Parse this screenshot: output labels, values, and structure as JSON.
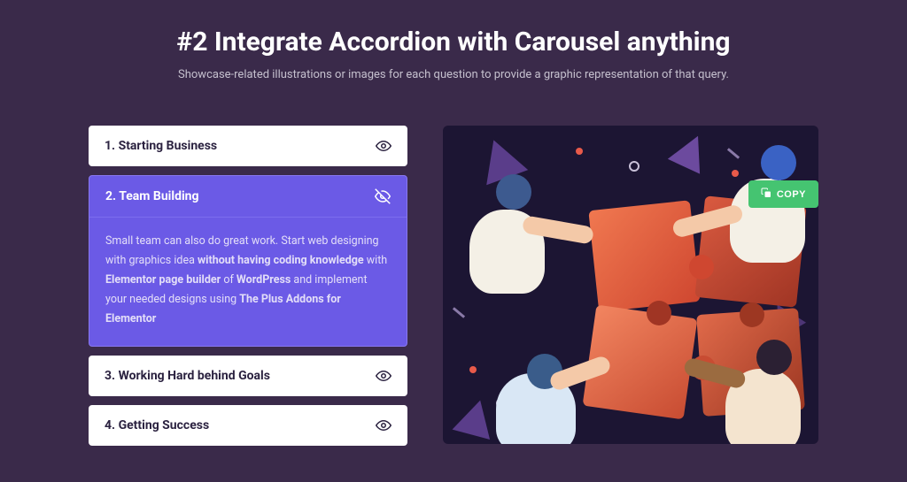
{
  "heading": "#2 Integrate Accordion with Carousel anything",
  "subheading": "Showcase-related illustrations or images for each question to provide a graphic representation of that query.",
  "accordion": [
    {
      "title": "1. Starting Business"
    },
    {
      "title": "2. Team Building"
    },
    {
      "title": "3. Working Hard behind Goals"
    },
    {
      "title": "4. Getting Success"
    }
  ],
  "active_body": {
    "t1": "Small team can also do great work. Start web designing with graphics idea ",
    "b1": "without having coding knowledge",
    "t2": " with ",
    "b2": "Elementor page builder",
    "t3": " of ",
    "b3": "WordPress",
    "t4": " and implement your needed designs using ",
    "b4": "The Plus Addons for Elementor"
  },
  "copy_label": "COPY"
}
